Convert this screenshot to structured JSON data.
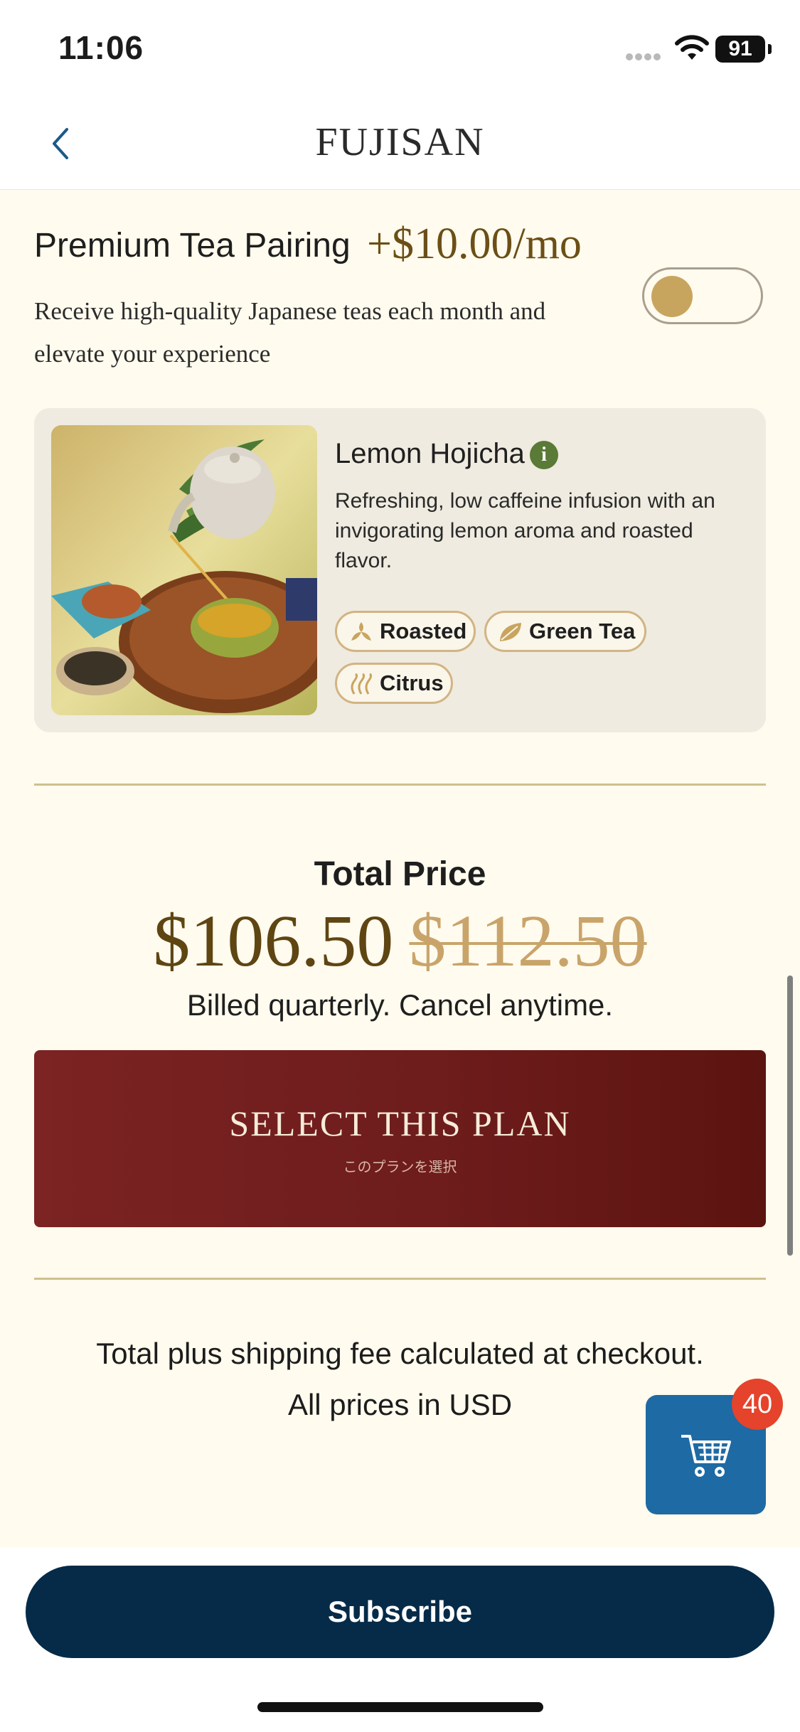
{
  "status_bar": {
    "time": "11:06",
    "battery": "91"
  },
  "nav": {
    "brand": "FUJISAN"
  },
  "addon": {
    "title": "Premium Tea Pairing",
    "price": "+$10.00/mo",
    "description": "Receive high-quality Japanese teas each month and elevate your experience",
    "toggle_on": false
  },
  "tea": {
    "name": "Lemon Hojicha",
    "description": "Refreshing, low caffeine infusion with an invigorating lemon aroma and roasted flavor.",
    "tags": [
      "Roasted",
      "Green Tea",
      "Citrus"
    ]
  },
  "pricing": {
    "label": "Total Price",
    "price": "$106.50",
    "original_price": "$112.50",
    "billing_note": "Billed quarterly. Cancel anytime."
  },
  "cta": {
    "label": "SELECT THIS PLAN",
    "sublabel": "このプランを選択"
  },
  "notes": {
    "shipping": "Total plus shipping fee calculated at checkout.",
    "currency": "All prices in USD"
  },
  "cart": {
    "count": "40"
  },
  "footer": {
    "subscribe_label": "Subscribe"
  },
  "colors": {
    "background": "#fffbee",
    "accent_gold": "#c8a55e",
    "plan_button": "#7c2323",
    "subscribe_button": "#052b48",
    "cart_button": "#1e6aa4",
    "badge": "#e5432c"
  }
}
